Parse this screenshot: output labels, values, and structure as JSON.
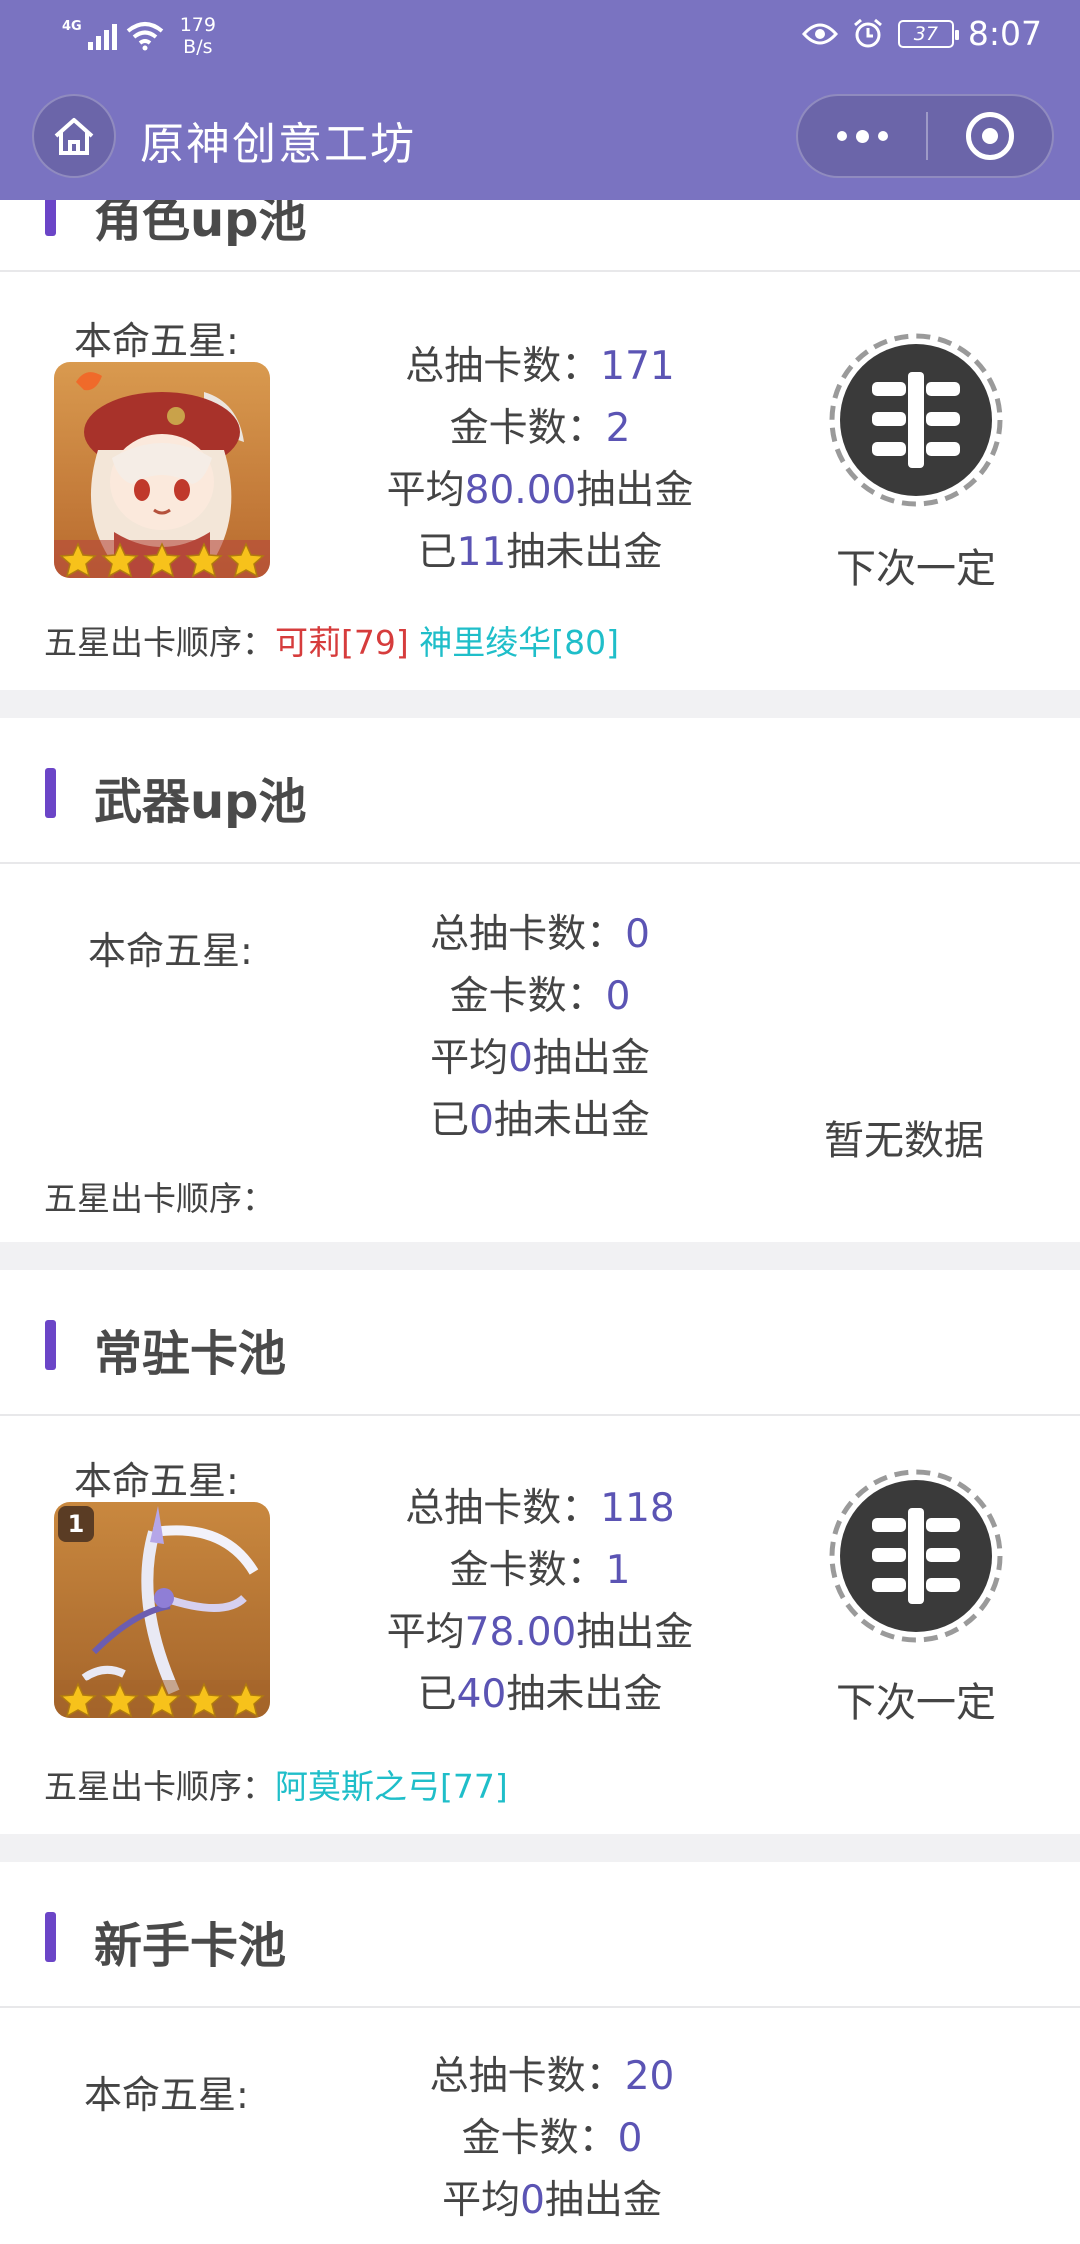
{
  "status_bar": {
    "network": "4G",
    "speed_value": "179",
    "speed_unit": "B/s",
    "battery": "37",
    "time": "8:07"
  },
  "nav": {
    "title": "原神创意工坊"
  },
  "pools": [
    {
      "title": "角色up池",
      "five_star_label": "本命五星:",
      "total_label": "总抽卡数：",
      "total": "171",
      "gold_label": "金卡数：",
      "gold": "2",
      "avg_prefix": "平均",
      "avg": "80.00",
      "avg_suffix": "抽出金",
      "since_prefix": "已",
      "since": "11",
      "since_suffix": "抽未出金",
      "next_label": "下次一定",
      "order_label": "五星出卡顺序：",
      "order": [
        {
          "text": "可莉[79]",
          "color": "#d63c3c"
        },
        {
          "text": "神里绫华[80]",
          "color": "#1fbec9"
        }
      ]
    },
    {
      "title": "武器up池",
      "five_star_label": "本命五星:",
      "total_label": "总抽卡数：",
      "total": "0",
      "gold_label": "金卡数：",
      "gold": "0",
      "avg_prefix": "平均",
      "avg": "0",
      "avg_suffix": "抽出金",
      "since_prefix": "已",
      "since": "0",
      "since_suffix": "抽未出金",
      "no_data": "暂无数据",
      "order_label": "五星出卡顺序："
    },
    {
      "title": "常驻卡池",
      "five_star_label": "本命五星:",
      "total_label": "总抽卡数：",
      "total": "118",
      "gold_label": "金卡数：",
      "gold": "1",
      "avg_prefix": "平均",
      "avg": "78.00",
      "avg_suffix": "抽出金",
      "since_prefix": "已",
      "since": "40",
      "since_suffix": "抽未出金",
      "next_label": "下次一定",
      "weapon_badge": "1",
      "order_label": "五星出卡顺序：",
      "order": [
        {
          "text": "阿莫斯之弓[77]",
          "color": "#1fbec9"
        }
      ]
    },
    {
      "title": "新手卡池",
      "five_star_label": "本命五星:",
      "total_label": "总抽卡数：",
      "total": "20",
      "gold_label": "金卡数：",
      "gold": "0",
      "avg_prefix": "平均",
      "avg": "0",
      "avg_suffix": "抽出金"
    }
  ],
  "colors": {
    "header": "#7a73c1",
    "accent_bar": "#6b45c7",
    "value": "#5b54b4",
    "order_red": "#d63c3c",
    "order_cyan": "#1fbec9"
  }
}
